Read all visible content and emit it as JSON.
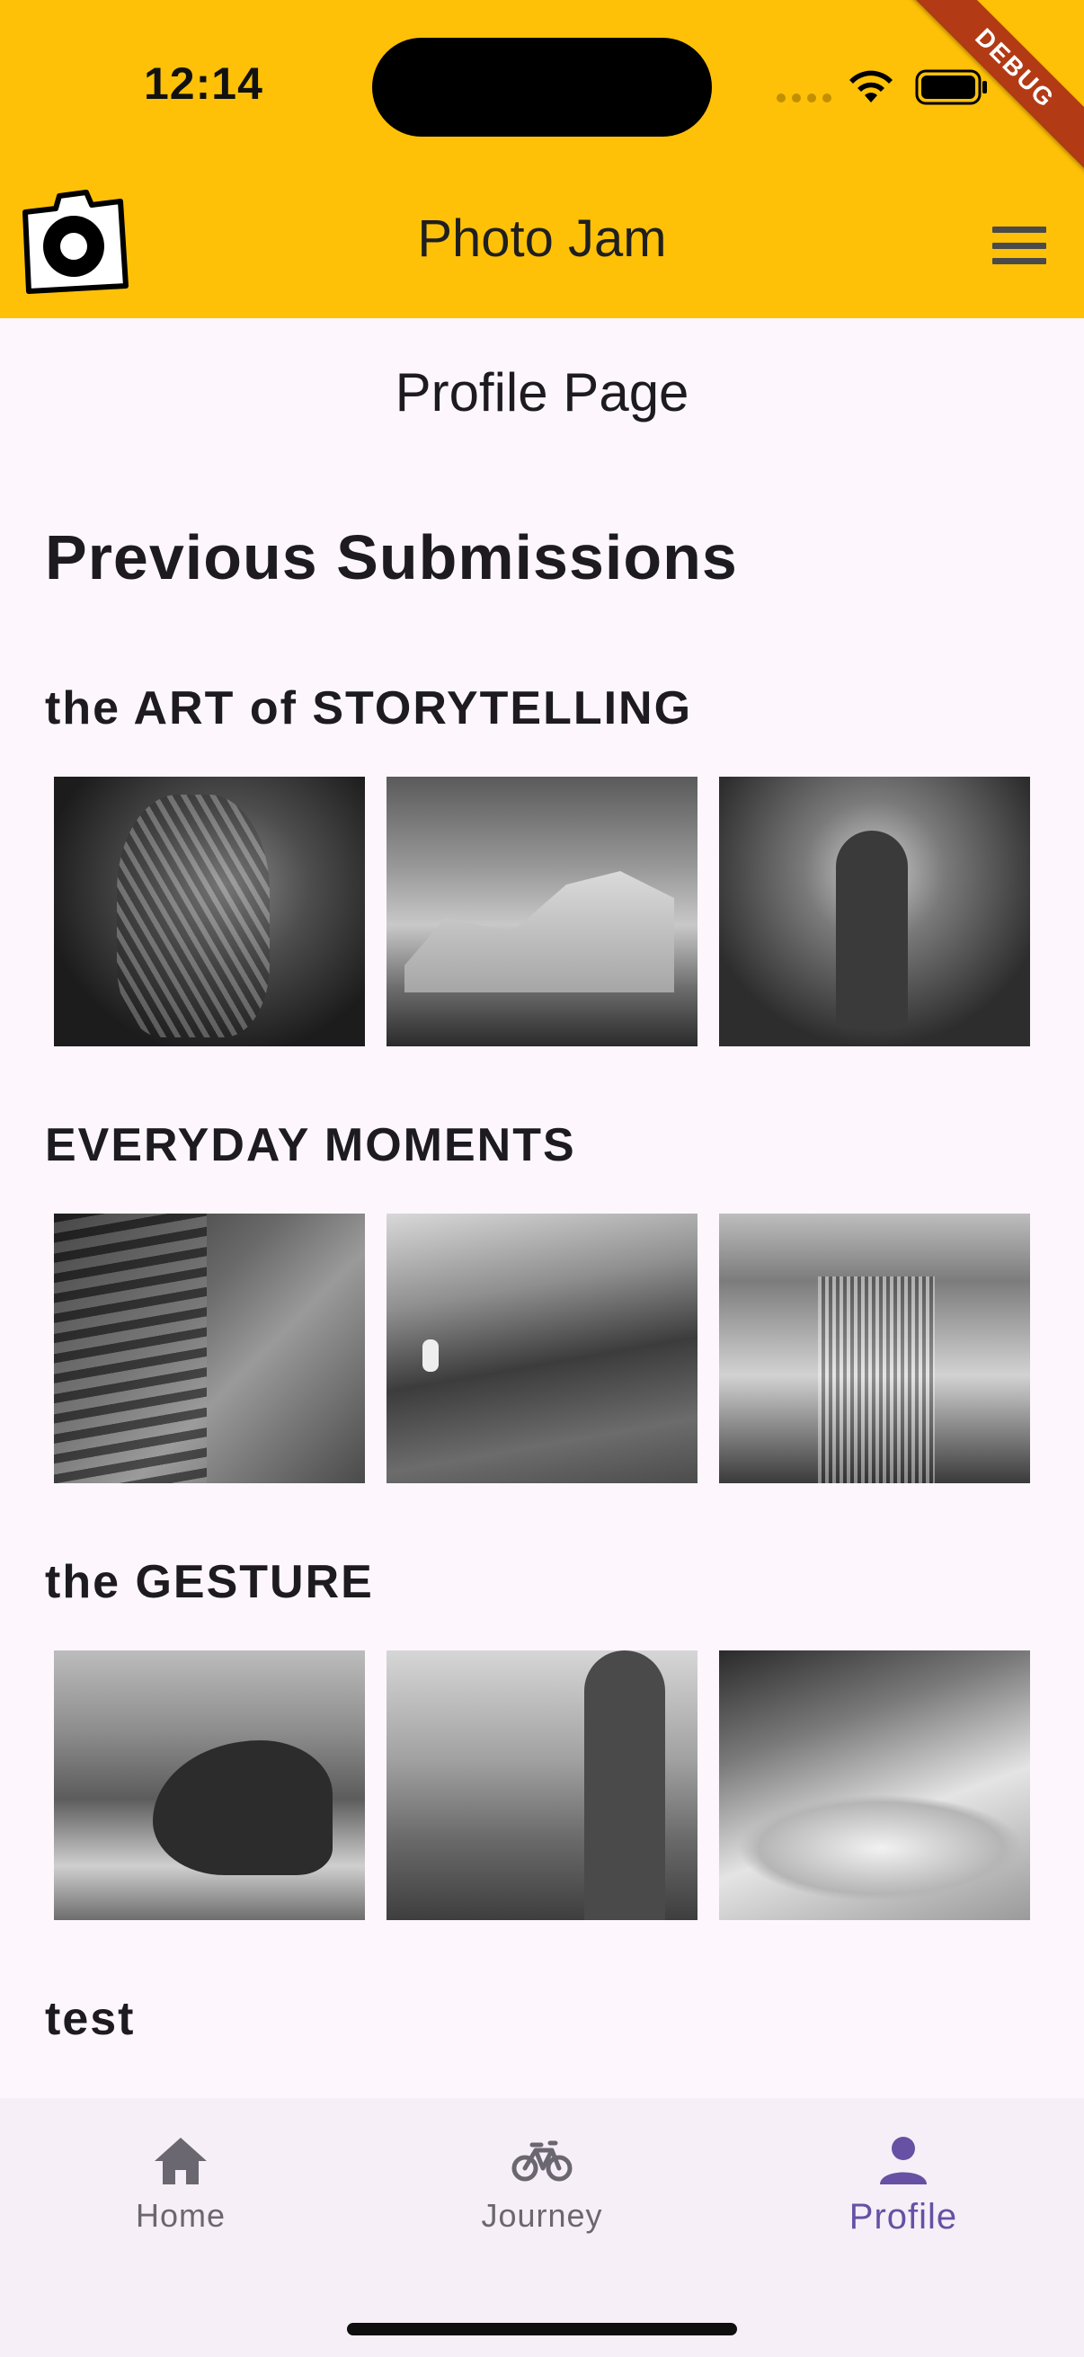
{
  "status_bar": {
    "time": "12:14"
  },
  "debug_banner": "DEBUG",
  "app_bar": {
    "title": "Photo Jam",
    "logo_icon": "camera-logo-icon",
    "menu_icon": "hamburger-menu-icon",
    "background_color": "#fec107"
  },
  "page": {
    "heading": "Profile Page",
    "section_title": "Previous Submissions"
  },
  "albums": [
    {
      "title": "the ART of STORYTELLING",
      "photos": 3
    },
    {
      "title": "EVERYDAY MOMENTS",
      "photos": 3
    },
    {
      "title": "the GESTURE",
      "photos": 3
    },
    {
      "title": "test",
      "photos": 0
    }
  ],
  "bottom_nav": {
    "items": [
      {
        "label": "Home",
        "icon": "home-icon",
        "active": false
      },
      {
        "label": "Journey",
        "icon": "bicycle-icon",
        "active": false
      },
      {
        "label": "Profile",
        "icon": "person-icon",
        "active": true
      }
    ],
    "active_color": "#6651a4",
    "inactive_color": "#6b6770"
  }
}
